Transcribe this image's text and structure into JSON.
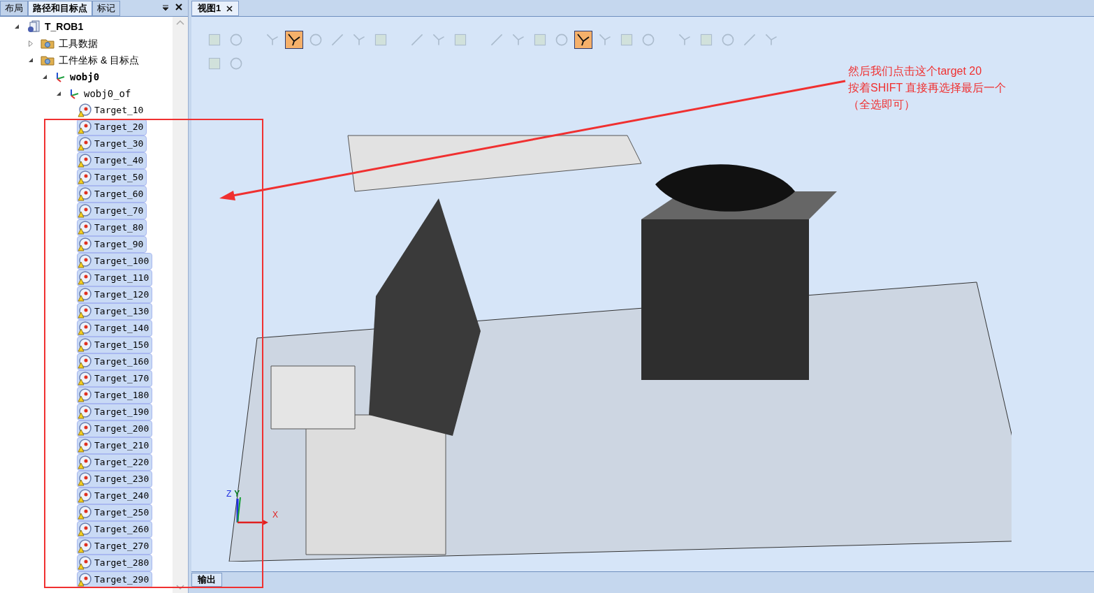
{
  "left_panel": {
    "tabs": [
      {
        "label": "布局",
        "selected": false
      },
      {
        "label": "路径和目标点",
        "selected": true
      },
      {
        "label": "标记",
        "selected": false
      }
    ],
    "tree": [
      {
        "label": "T_ROB1",
        "kind": "task",
        "bold": true,
        "expanded": true,
        "children": [
          {
            "label": "工具数据",
            "kind": "folder",
            "bold": false,
            "expanded": false
          },
          {
            "label": "工件坐标 & 目标点",
            "kind": "folder",
            "bold": false,
            "expanded": true,
            "children": [
              {
                "label": "wobj0",
                "kind": "frame",
                "bold": true,
                "expanded": true,
                "children": [
                  {
                    "label": "wobj0_of",
                    "kind": "frame",
                    "bold": false,
                    "expanded": true,
                    "children": [
                      {
                        "label": "Target_10",
                        "kind": "target",
                        "selected": false
                      },
                      {
                        "label": "Target_20",
                        "kind": "target",
                        "selected": true
                      },
                      {
                        "label": "Target_30",
                        "kind": "target",
                        "selected": true
                      },
                      {
                        "label": "Target_40",
                        "kind": "target",
                        "selected": true
                      },
                      {
                        "label": "Target_50",
                        "kind": "target",
                        "selected": true
                      },
                      {
                        "label": "Target_60",
                        "kind": "target",
                        "selected": true
                      },
                      {
                        "label": "Target_70",
                        "kind": "target",
                        "selected": true
                      },
                      {
                        "label": "Target_80",
                        "kind": "target",
                        "selected": true
                      },
                      {
                        "label": "Target_90",
                        "kind": "target",
                        "selected": true
                      },
                      {
                        "label": "Target_100",
                        "kind": "target",
                        "selected": true
                      },
                      {
                        "label": "Target_110",
                        "kind": "target",
                        "selected": true
                      },
                      {
                        "label": "Target_120",
                        "kind": "target",
                        "selected": true
                      },
                      {
                        "label": "Target_130",
                        "kind": "target",
                        "selected": true
                      },
                      {
                        "label": "Target_140",
                        "kind": "target",
                        "selected": true
                      },
                      {
                        "label": "Target_150",
                        "kind": "target",
                        "selected": true
                      },
                      {
                        "label": "Target_160",
                        "kind": "target",
                        "selected": true
                      },
                      {
                        "label": "Target_170",
                        "kind": "target",
                        "selected": true
                      },
                      {
                        "label": "Target_180",
                        "kind": "target",
                        "selected": true
                      },
                      {
                        "label": "Target_190",
                        "kind": "target",
                        "selected": true
                      },
                      {
                        "label": "Target_200",
                        "kind": "target",
                        "selected": true
                      },
                      {
                        "label": "Target_210",
                        "kind": "target",
                        "selected": true
                      },
                      {
                        "label": "Target_220",
                        "kind": "target",
                        "selected": true
                      },
                      {
                        "label": "Target_230",
                        "kind": "target",
                        "selected": true
                      },
                      {
                        "label": "Target_240",
                        "kind": "target",
                        "selected": true
                      },
                      {
                        "label": "Target_250",
                        "kind": "target",
                        "selected": true
                      },
                      {
                        "label": "Target_260",
                        "kind": "target",
                        "selected": true
                      },
                      {
                        "label": "Target_270",
                        "kind": "target",
                        "selected": true
                      },
                      {
                        "label": "Target_280",
                        "kind": "target",
                        "selected": true
                      },
                      {
                        "label": "Target_290",
                        "kind": "target",
                        "selected": true
                      }
                    ]
                  }
                ]
              }
            ]
          }
        ]
      }
    ]
  },
  "view": {
    "tab": {
      "label": "视图1",
      "selected": true
    },
    "toolbar": [
      [
        {
          "kind": "tool",
          "active": false
        },
        {
          "kind": "tool",
          "active": false
        },
        {
          "kind": "gap"
        },
        {
          "kind": "tool",
          "active": false
        },
        {
          "kind": "tool",
          "active": true
        },
        {
          "kind": "tool",
          "active": false
        },
        {
          "kind": "tool",
          "active": false
        },
        {
          "kind": "tool",
          "active": false
        },
        {
          "kind": "tool",
          "active": false
        },
        {
          "kind": "gap"
        },
        {
          "kind": "tool",
          "active": false
        },
        {
          "kind": "tool",
          "active": false
        },
        {
          "kind": "tool",
          "active": false
        },
        {
          "kind": "gap"
        },
        {
          "kind": "tool",
          "active": false
        },
        {
          "kind": "tool",
          "active": false
        },
        {
          "kind": "tool",
          "active": false
        },
        {
          "kind": "tool",
          "active": false
        },
        {
          "kind": "tool",
          "active": true
        },
        {
          "kind": "tool",
          "active": false
        },
        {
          "kind": "tool",
          "active": false
        },
        {
          "kind": "tool",
          "active": false
        },
        {
          "kind": "gap"
        },
        {
          "kind": "tool",
          "active": false
        },
        {
          "kind": "tool",
          "active": false
        },
        {
          "kind": "tool",
          "active": false
        },
        {
          "kind": "tool",
          "active": false
        },
        {
          "kind": "tool",
          "active": false
        }
      ],
      [
        {
          "kind": "tool",
          "active": false
        },
        {
          "kind": "tool",
          "active": false
        }
      ]
    ],
    "axis_labels": [
      "Z",
      "Y",
      "X"
    ],
    "annotation": [
      "然后我们点击这个target 20",
      "按着SHIFT 直接再选择最后一个",
      "（全选即可）"
    ]
  },
  "bottom_panel": {
    "tab": {
      "label": "输出",
      "selected": true
    }
  }
}
